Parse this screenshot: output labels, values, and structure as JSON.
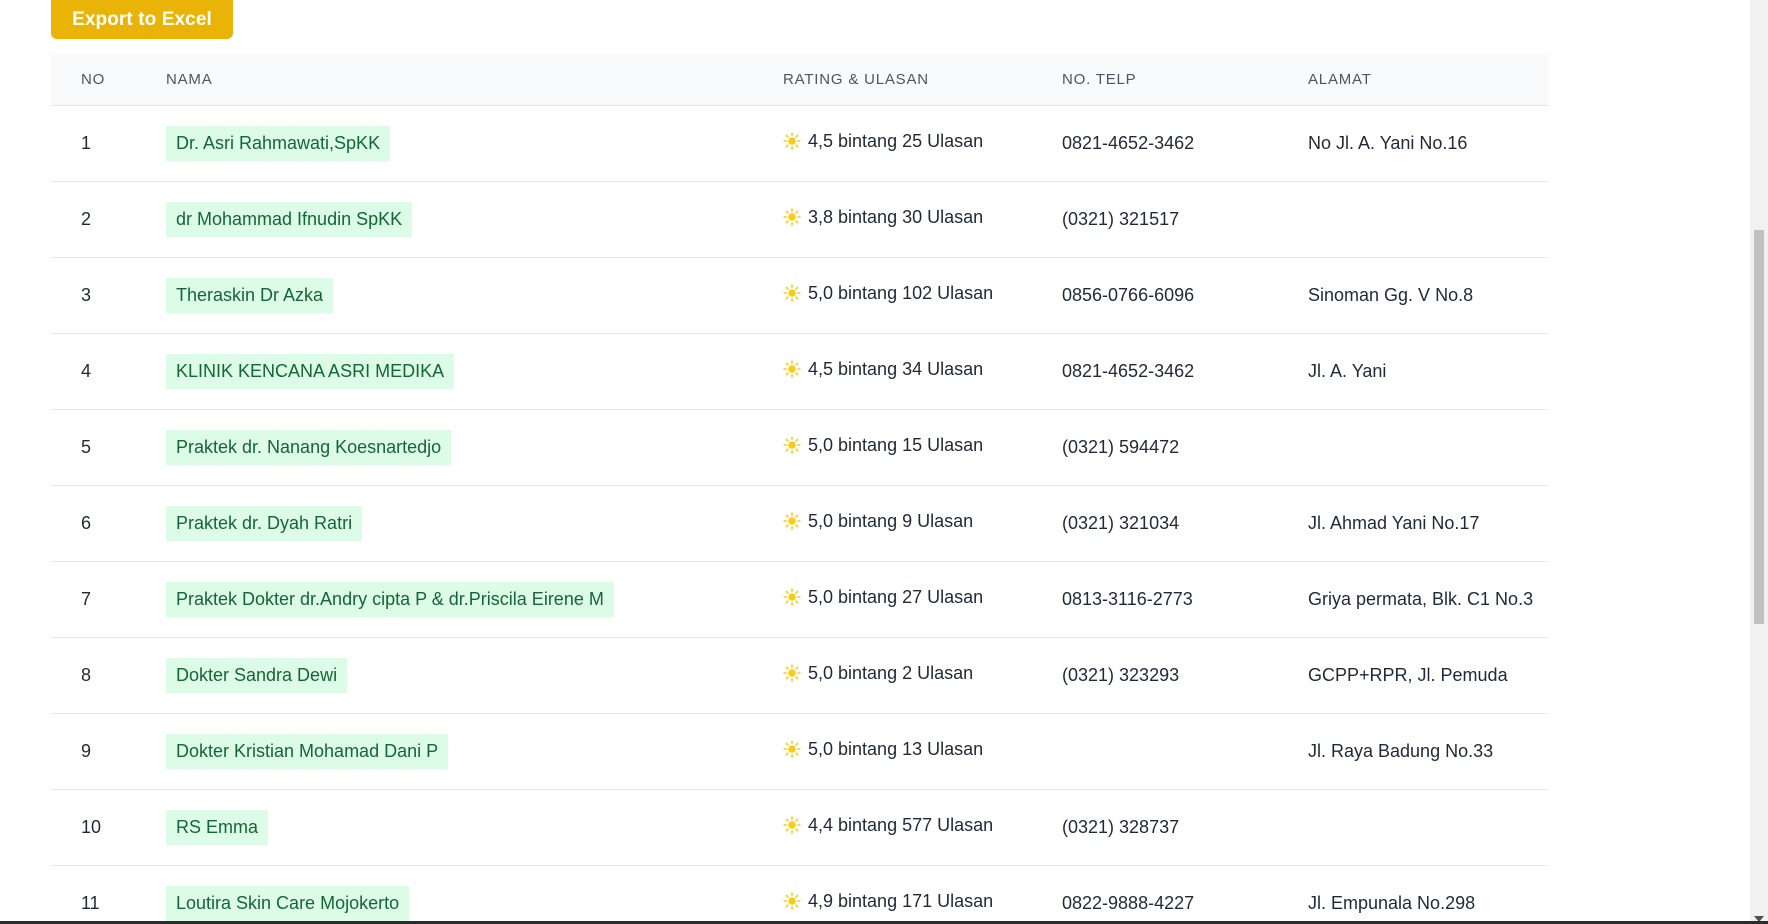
{
  "toolbar": {
    "export_label": "Export to Excel",
    "accent": "#eab308"
  },
  "table": {
    "headers": [
      "NO",
      "NAMA",
      "RATING & ULASAN",
      "NO. TELP",
      "ALAMAT"
    ],
    "rating_icon": "sun-icon",
    "badge_color": "#dcfce7",
    "badge_text_color": "#166534",
    "rows": [
      {
        "no": "1",
        "nama": "Dr. Asri Rahmawati,SpKK",
        "rating": "4,5 bintang 25 Ulasan",
        "telp": "0821-4652-3462",
        "alamat": "No Jl. A. Yani No.16"
      },
      {
        "no": "2",
        "nama": "dr Mohammad Ifnudin SpKK",
        "rating": "3,8 bintang 30 Ulasan",
        "telp": "(0321) 321517",
        "alamat": ""
      },
      {
        "no": "3",
        "nama": "Theraskin Dr Azka",
        "rating": "5,0 bintang 102 Ulasan",
        "telp": "0856-0766-6096",
        "alamat": "Sinoman Gg. V No.8"
      },
      {
        "no": "4",
        "nama": "KLINIK KENCANA ASRI MEDIKA",
        "rating": "4,5 bintang 34 Ulasan",
        "telp": "0821-4652-3462",
        "alamat": "Jl. A. Yani"
      },
      {
        "no": "5",
        "nama": "Praktek dr. Nanang Koesnartedjo",
        "rating": "5,0 bintang 15 Ulasan",
        "telp": "(0321) 594472",
        "alamat": ""
      },
      {
        "no": "6",
        "nama": "Praktek dr. Dyah Ratri",
        "rating": "5,0 bintang 9 Ulasan",
        "telp": "(0321) 321034",
        "alamat": "Jl. Ahmad Yani No.17"
      },
      {
        "no": "7",
        "nama": "Praktek Dokter dr.Andry cipta P & dr.Priscila Eirene M",
        "rating": "5,0 bintang 27 Ulasan",
        "telp": "0813-3116-2773",
        "alamat": "Griya permata, Blk. C1 No.3"
      },
      {
        "no": "8",
        "nama": "Dokter Sandra Dewi",
        "rating": "5,0 bintang 2 Ulasan",
        "telp": "(0321) 323293",
        "alamat": "GCPP+RPR, Jl. Pemuda"
      },
      {
        "no": "9",
        "nama": "Dokter Kristian Mohamad Dani P",
        "rating": "5,0 bintang 13 Ulasan",
        "telp": "",
        "alamat": "Jl. Raya Badung No.33"
      },
      {
        "no": "10",
        "nama": "RS Emma",
        "rating": "4,4 bintang 577 Ulasan",
        "telp": "(0321) 328737",
        "alamat": ""
      },
      {
        "no": "11",
        "nama": "Loutira Skin Care Mojokerto",
        "rating": "4,9 bintang 171 Ulasan",
        "telp": "0822-9888-4227",
        "alamat": "Jl. Empunala No.298"
      }
    ]
  },
  "scrollbar": {
    "position_fraction": 0.26
  }
}
